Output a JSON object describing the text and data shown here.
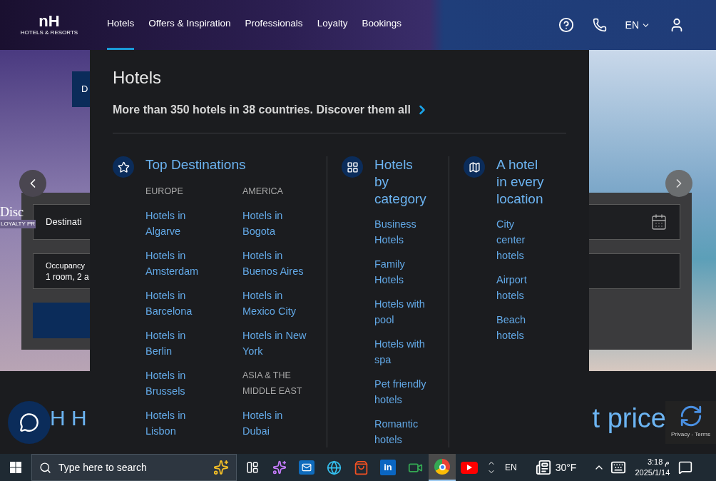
{
  "header": {
    "logo": {
      "mark": "nH",
      "text": "HOTELS & RESORTS"
    },
    "nav": [
      {
        "label": "Hotels",
        "selected": true
      },
      {
        "label": "Offers & Inspiration",
        "selected": false
      },
      {
        "label": "Professionals",
        "selected": false
      },
      {
        "label": "Loyalty",
        "selected": false
      },
      {
        "label": "Bookings",
        "selected": false
      }
    ],
    "language": "EN"
  },
  "hero": {
    "promo_button": "D",
    "caption": {
      "title": "Disc",
      "subtitle": "LOYALTY PR"
    },
    "search": {
      "destination_placeholder": "Destinati",
      "occupancy": {
        "label": "Occupancy",
        "value": "1 room, 2 a"
      }
    }
  },
  "banner": {
    "left_text": "H H",
    "right_text": "t price"
  },
  "menu": {
    "title": "Hotels",
    "subtitle": "More than 350 hotels in 38 countries. Discover them all",
    "columns": [
      {
        "kind": "destinations",
        "title": "Top Destinations",
        "subcolumns": [
          {
            "items": [
              {
                "kind": "heading",
                "text": "EUROPE"
              },
              {
                "kind": "link",
                "text": "Hotels in Algarve"
              },
              {
                "kind": "link",
                "text": "Hotels in Amsterdam"
              },
              {
                "kind": "link",
                "text": "Hotels in Barcelona"
              },
              {
                "kind": "link",
                "text": "Hotels in Berlin"
              },
              {
                "kind": "link",
                "text": "Hotels in Brussels"
              },
              {
                "kind": "link",
                "text": "Hotels in Lisbon"
              }
            ]
          },
          {
            "items": [
              {
                "kind": "heading",
                "text": "AMERICA"
              },
              {
                "kind": "link",
                "text": "Hotels in Bogota"
              },
              {
                "kind": "link",
                "text": "Hotels in Buenos Aires"
              },
              {
                "kind": "link",
                "text": "Hotels in Mexico City"
              },
              {
                "kind": "link",
                "text": "Hotels in New York"
              },
              {
                "kind": "heading",
                "text": "ASIA & THE MIDDLE EAST"
              },
              {
                "kind": "link",
                "text": "Hotels in Dubai"
              }
            ]
          }
        ]
      },
      {
        "kind": "category",
        "title": "Hotels by category",
        "links": [
          "Business Hotels",
          "Family Hotels",
          "Hotels with pool",
          "Hotels with spa",
          "Pet friendly hotels",
          "Romantic hotels"
        ]
      },
      {
        "kind": "location",
        "title": "A hotel in every location",
        "links": [
          "City center hotels",
          "Airport hotels",
          "Beach hotels"
        ]
      }
    ]
  },
  "recaptcha": {
    "text": "Privacy - Terms"
  },
  "taskbar": {
    "search_placeholder": "Type here to search",
    "apps": [
      {
        "kind": "copilot",
        "selected": false
      },
      {
        "kind": "outlook",
        "selected": false
      },
      {
        "kind": "edge",
        "selected": false
      },
      {
        "kind": "store",
        "selected": false
      },
      {
        "kind": "linkedin",
        "label": "in",
        "selected": false
      },
      {
        "kind": "meet",
        "selected": false
      },
      {
        "kind": "chrome",
        "selected": true
      },
      {
        "kind": "youtube",
        "selected": false
      }
    ],
    "language": "EN",
    "weather": "30°F",
    "time": "3:18 م",
    "date": "2025/1/14"
  }
}
